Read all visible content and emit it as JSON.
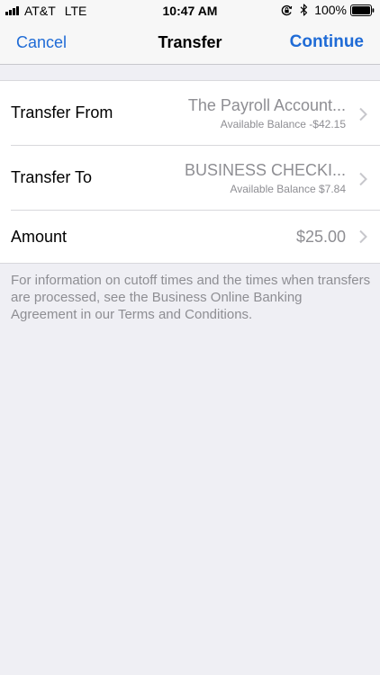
{
  "status_bar": {
    "carrier": "AT&T",
    "network": "LTE",
    "time": "10:47 AM",
    "battery": "100%",
    "icons": [
      "signal-icon",
      "orientation-lock-icon",
      "bluetooth-icon",
      "battery-icon"
    ]
  },
  "nav": {
    "cancel": "Cancel",
    "title": "Transfer",
    "continue": "Continue",
    "accent_color": "#1f6bd6"
  },
  "form": {
    "from": {
      "label": "Transfer From",
      "value": "The Payroll Account...",
      "balance": "Available Balance -$42.15"
    },
    "to": {
      "label": "Transfer To",
      "value": "BUSINESS CHECKI...",
      "balance": "Available Balance $7.84"
    },
    "amount": {
      "label": "Amount",
      "value": "$25.00"
    }
  },
  "footnote": "For information on cutoff times and the times when transfers are processed, see the Business Online Banking Agreement in our Terms and Conditions."
}
